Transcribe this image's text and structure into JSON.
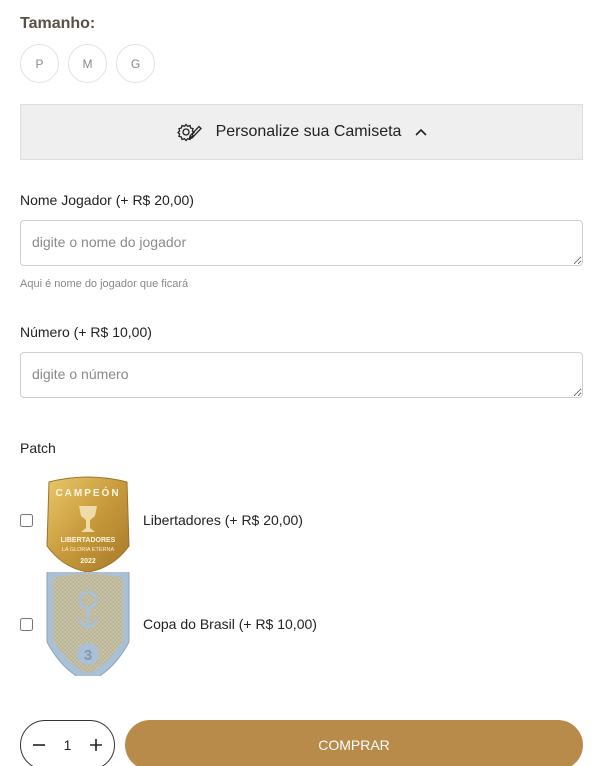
{
  "size": {
    "title": "Tamanho:",
    "options": [
      "P",
      "M",
      "G"
    ]
  },
  "personalize": {
    "label": "Personalize sua Camiseta",
    "icon": "gear-pen-icon",
    "toggle_icon": "chevron-up-icon"
  },
  "player_name": {
    "label": "Nome Jogador (+ R$ 20,00)",
    "placeholder": "digite o nome do jogador",
    "hint": "Aqui é nome do jogador que ficará"
  },
  "number": {
    "label": "Número (+ R$ 10,00)",
    "placeholder": "digite o número"
  },
  "patch": {
    "title": "Patch",
    "items": [
      {
        "label": "Libertadores (+ R$ 20,00)",
        "badge_top": "CAMPEÓN",
        "badge_mid": "LIBERTADORES",
        "badge_sub": "LA GLORIA ETERNA",
        "badge_year": "2022"
      },
      {
        "label": "Copa do Brasil (+ R$ 10,00)",
        "badge_num": "3"
      }
    ]
  },
  "quantity": {
    "value": "1"
  },
  "buy_button": {
    "label": "COMPRAR"
  },
  "colors": {
    "accent": "#b98b4b",
    "panel": "#efefef"
  }
}
